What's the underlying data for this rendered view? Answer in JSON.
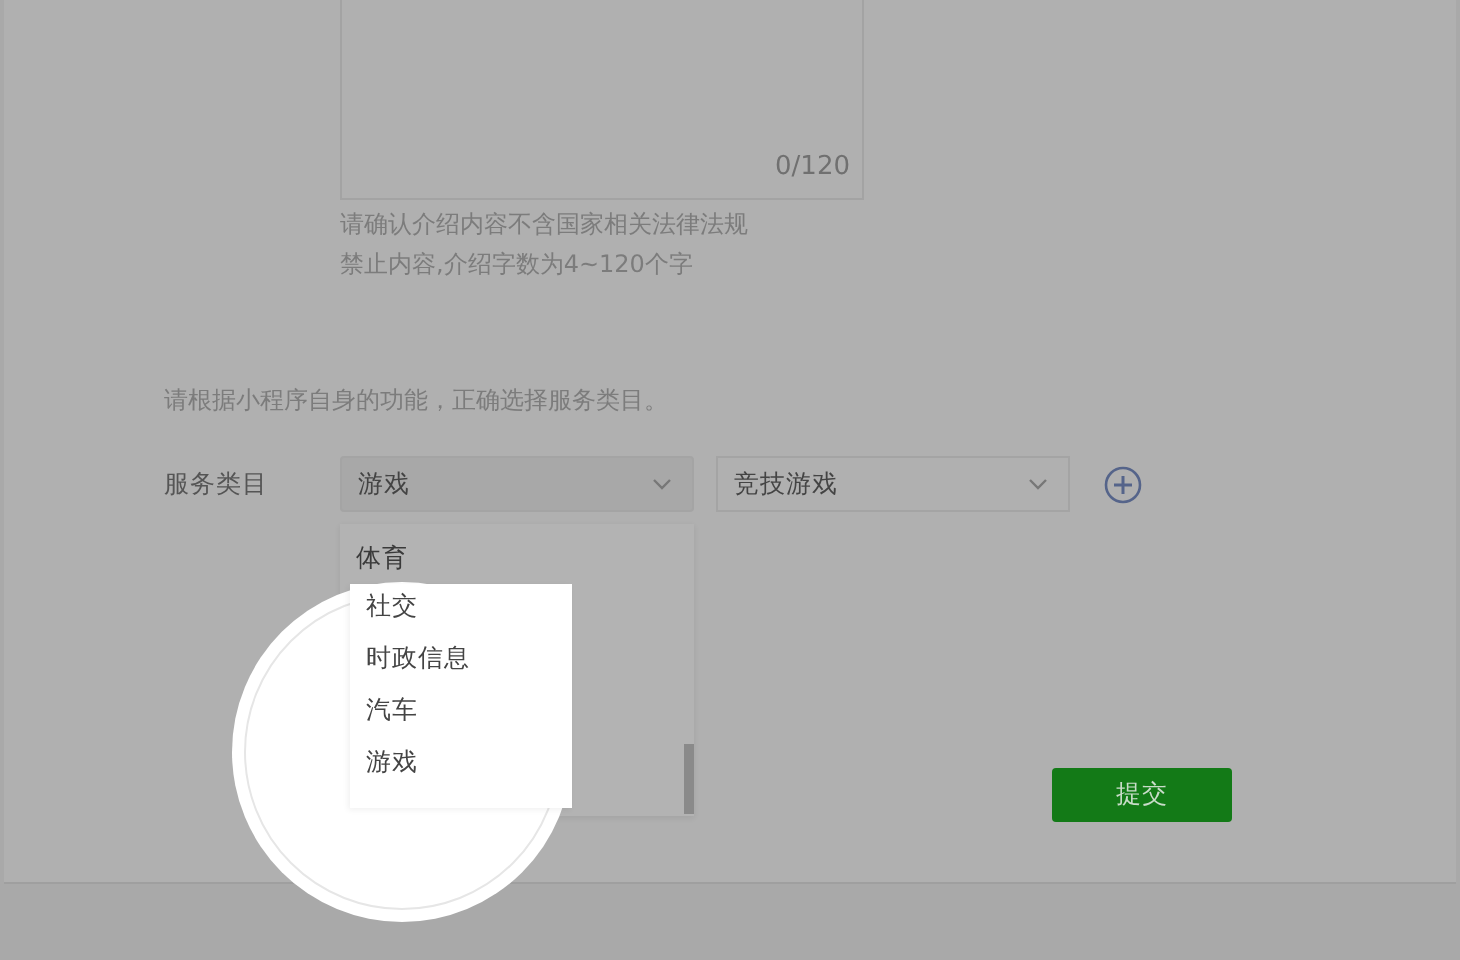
{
  "intro_textarea": {
    "counter": "0/120"
  },
  "hints": [
    "请确认介绍内容不含国家相关法律法规",
    "禁止内容,介绍字数为4~120个字"
  ],
  "category_note": "请根据小程序自身的功能，正确选择服务类目。",
  "service_category": {
    "label": "服务类目",
    "primary": "游戏",
    "secondary": "竞技游戏"
  },
  "dropdown_options": [
    "体育",
    "社交",
    "时政信息",
    "汽车",
    "游戏"
  ],
  "submit_button": "提交"
}
